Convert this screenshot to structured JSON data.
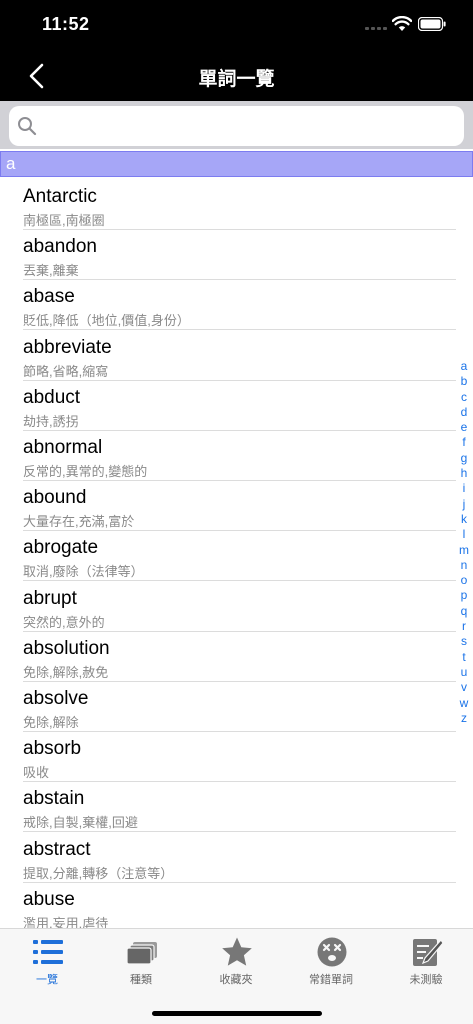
{
  "status_bar": {
    "time": "11:52"
  },
  "nav": {
    "title": "單詞一覽"
  },
  "search": {
    "value": "",
    "placeholder": ""
  },
  "section": {
    "letter": "a"
  },
  "words": [
    {
      "word": "Antarctic",
      "meaning": "南極區,南極圈"
    },
    {
      "word": "abandon",
      "meaning": "丟棄,離棄"
    },
    {
      "word": "abase",
      "meaning": "貶低,降低（地位,價值,身份）"
    },
    {
      "word": "abbreviate",
      "meaning": "節略,省略,縮寫"
    },
    {
      "word": "abduct",
      "meaning": "劫持,誘拐"
    },
    {
      "word": "abnormal",
      "meaning": "反常的,異常的,變態的"
    },
    {
      "word": "abound",
      "meaning": "大量存在,充滿,富於"
    },
    {
      "word": "abrogate",
      "meaning": "取消,廢除（法律等）"
    },
    {
      "word": "abrupt",
      "meaning": "突然的,意外的"
    },
    {
      "word": "absolution",
      "meaning": "免除,解除,赦免"
    },
    {
      "word": "absolve",
      "meaning": "免除,解除"
    },
    {
      "word": "absorb",
      "meaning": "吸收"
    },
    {
      "word": "abstain",
      "meaning": "戒除,自製,棄權,回避"
    },
    {
      "word": "abstract",
      "meaning": "提取,分離,轉移（注意等）"
    },
    {
      "word": "abuse",
      "meaning": "濫用,妄用,虐待"
    }
  ],
  "index": [
    "a",
    "b",
    "c",
    "d",
    "e",
    "f",
    "g",
    "h",
    "i",
    "j",
    "k",
    "l",
    "m",
    "n",
    "o",
    "p",
    "q",
    "r",
    "s",
    "t",
    "u",
    "v",
    "w",
    "z"
  ],
  "tabs": [
    {
      "label": "一覽",
      "icon": "list-icon",
      "active": true
    },
    {
      "label": "種類",
      "icon": "cards-icon",
      "active": false
    },
    {
      "label": "收藏夾",
      "icon": "star-icon",
      "active": false
    },
    {
      "label": "常錯單詞",
      "icon": "dizzy-face-icon",
      "active": false
    },
    {
      "label": "未測驗",
      "icon": "edit-note-icon",
      "active": false
    }
  ],
  "colors": {
    "accent": "#1e6fd9",
    "section_header": "#a6a6f7",
    "nav_bg": "#000000"
  }
}
